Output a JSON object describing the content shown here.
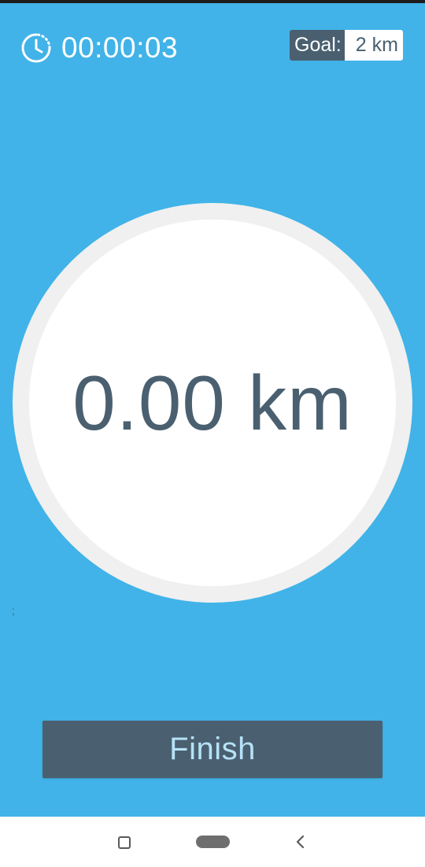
{
  "timer": {
    "icon": "stopwatch-icon",
    "elapsed": "00:00:03"
  },
  "goal": {
    "label": "Goal:",
    "value": "2 km"
  },
  "distance": {
    "value": "0.00 km"
  },
  "stray_mark": ";",
  "finish_button": {
    "label": "Finish"
  },
  "navigation": {
    "recents_icon": "square-icon",
    "home_icon": "pill-icon",
    "back_icon": "chevron-left-icon"
  },
  "colors": {
    "background": "#41b3e8",
    "accent_dark": "#4a6070",
    "ring": "#f0f0f0",
    "finish_text": "#b7e2f7"
  }
}
